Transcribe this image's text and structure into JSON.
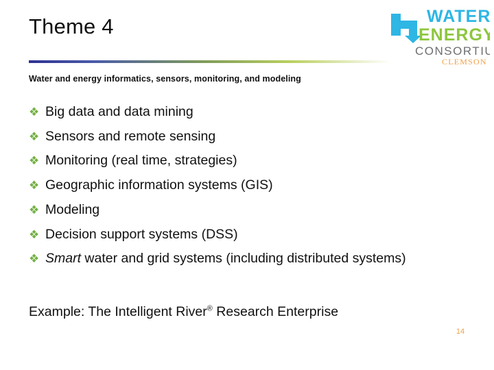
{
  "slide": {
    "title": "Theme 4",
    "subtitle": "Water and energy informatics, sensors, monitoring, and modeling",
    "bullet_marker": "❖",
    "bullets": [
      {
        "text": "Big data and data mining",
        "italic_prefix": ""
      },
      {
        "text": "Sensors and remote sensing",
        "italic_prefix": ""
      },
      {
        "text": "Monitoring (real time, strategies)",
        "italic_prefix": ""
      },
      {
        "text": "Geographic information systems (GIS)",
        "italic_prefix": ""
      },
      {
        "text": "Modeling",
        "italic_prefix": ""
      },
      {
        "text": "Decision support systems (DSS)",
        "italic_prefix": ""
      },
      {
        "text": " water and grid systems (including distributed systems)",
        "italic_prefix": "Smart"
      }
    ],
    "example_line": "Example: The Intelligent River",
    "example_sup": "®",
    "example_tail": " Research Enterprise",
    "page_number": "14",
    "accent_bullet_color": "#72b043",
    "page_number_color": "#f0a04b"
  },
  "logo": {
    "line1": "WATER",
    "line2": "ENERGY",
    "line3": "CONSORTIUM",
    "line4": "CLEMSON",
    "water_color": "#2eb6e4",
    "energy_color": "#8dc63f",
    "consortium_color": "#6d6e71",
    "clemson_color": "#f0a04b",
    "arrow_color": "#2eb6e4"
  }
}
